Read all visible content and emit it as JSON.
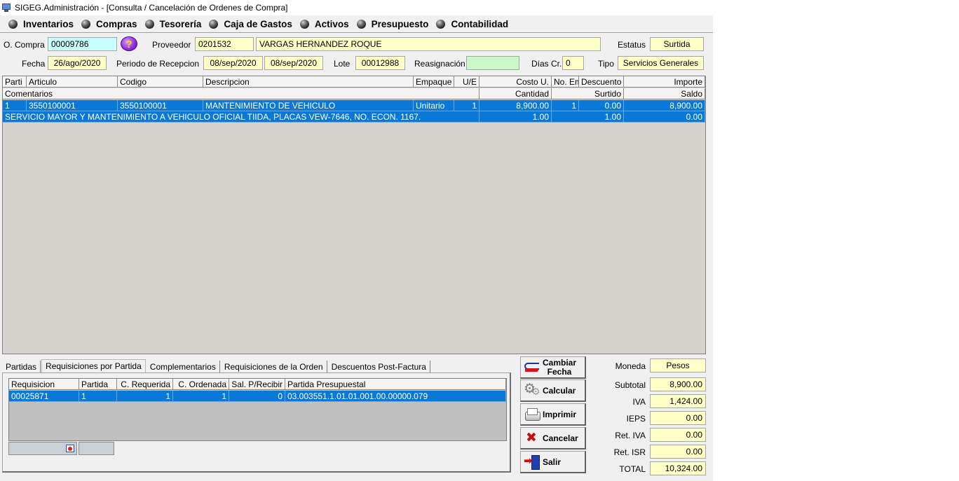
{
  "window": {
    "title": "SIGEG.Administración - [Consulta / Cancelación de Ordenes de Compra]"
  },
  "menu": [
    "Inventarios",
    "Compras",
    "Tesorería",
    "Caja de Gastos",
    "Activos",
    "Presupuesto",
    "Contabilidad"
  ],
  "header": {
    "orden_label": "O. Compra",
    "orden_value": "00009786",
    "help_glyph": "?",
    "proveedor_label": "Proveedor",
    "proveedor_code": "0201532",
    "proveedor_name": "VARGAS HERNANDEZ ROQUE",
    "estatus_label": "Estatus",
    "estatus_value": "Surtida",
    "fecha_label": "Fecha",
    "fecha_value": "26/ago/2020",
    "periodo_label": "Periodo de Recepcion",
    "periodo_desde": "08/sep/2020",
    "periodo_hasta": "08/sep/2020",
    "lote_label": "Lote",
    "lote_value": "00012988",
    "reasignacion_label": "Reasignación",
    "reasignacion_value": "",
    "dias_label": "Días Cr.",
    "dias_value": "0",
    "tipo_label": "Tipo",
    "tipo_value": "Servicios Generales"
  },
  "items_grid": {
    "headers1": [
      "Parti",
      "Articulo",
      "Codigo",
      "Descripcion",
      "Empaque",
      "U/E",
      "Costo U.",
      "No. Emp.",
      "Descuento",
      "Importe"
    ],
    "headers2": [
      "Comentarios",
      "Cantidad",
      "Surtido",
      "Saldo"
    ],
    "row1": [
      "1",
      "3550100001",
      "3550100001",
      "MANTENIMIENTO DE VEHICULO",
      "Unitario",
      "1",
      "8,900.00",
      "1",
      "0.00",
      "8,900.00"
    ],
    "row2": [
      "SERVICIO MAYOR Y MANTENIMIENTO A VEHICULO OFICIAL TIIDA, PLACAS VEW-7646, NO. ECON. 1167.",
      "1.00",
      "1.00",
      "0.00"
    ]
  },
  "tabs": [
    "Partidas",
    "Requisiciones por Partida",
    "Complementarios",
    "Requisiciones de la Orden",
    "Descuentos Post-Factura"
  ],
  "req_grid": {
    "headers": [
      "Requisicion",
      "Partida",
      "C. Requerida",
      "C. Ordenada",
      "Sal. P/Recibir",
      "Partida Presupuestal"
    ],
    "row": [
      "00025871",
      "1",
      "1",
      "1",
      "0",
      "03.003551.1.01.01.001.00.00000.079"
    ]
  },
  "buttons": {
    "cambiar_1": "Cambiar",
    "cambiar_2": "Fecha",
    "calcular": "Calcular",
    "imprimir": "Imprimir",
    "cancelar": "Cancelar",
    "salir": "Salir"
  },
  "totals": {
    "moneda_label": "Moneda",
    "moneda_value": "Pesos",
    "subtotal_label": "Subtotal",
    "subtotal_value": "8,900.00",
    "iva_label": "IVA",
    "iva_value": "1,424.00",
    "ieps_label": "IEPS",
    "ieps_value": "0.00",
    "retiva_label": "Ret. IVA",
    "retiva_value": "0.00",
    "retisr_label": "Ret. ISR",
    "retisr_value": "0.00",
    "total_label": "TOTAL",
    "total_value": "10,324.00"
  },
  "colors": {
    "selection": "#0a78d7",
    "field_yellow": "#ffffc8",
    "field_cyan": "#c8ffff",
    "field_green": "#c8f8c8",
    "grid_bg": "#d6d3ce"
  }
}
